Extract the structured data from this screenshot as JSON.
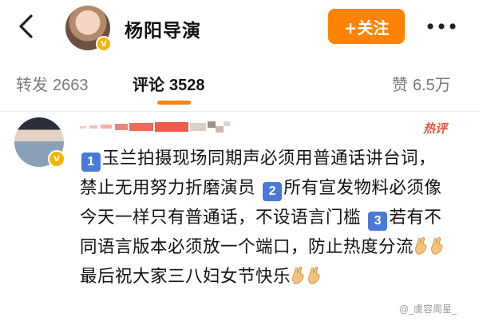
{
  "header": {
    "title": "杨阳导演",
    "follow_label": "+关注"
  },
  "tabs": {
    "repost": {
      "label": "转发",
      "count": "2663"
    },
    "comment": {
      "label": "评论",
      "count": "3528"
    },
    "like": {
      "label": "赞",
      "count": "6.5万"
    }
  },
  "comment": {
    "hot_tag": "热评",
    "items": [
      {
        "num": "1",
        "text": "玉兰拍摄现场同期声必须用普通话讲台词，禁止无用努力折磨演员"
      },
      {
        "num": "2",
        "text": "所有宣发物料必须像今天一样只有普通话，不设语言门槛"
      },
      {
        "num": "3",
        "text": "若有不同语言版本必须放一个端口，防止热度分流"
      }
    ],
    "closing": "最后祝大家三八妇女节快乐"
  },
  "watermark": "@_虞容周星_",
  "colors": {
    "accent": "#ff8200",
    "verified": "#f5b400",
    "number_badge": "#4a7ad8",
    "hot": "#e8563b"
  }
}
